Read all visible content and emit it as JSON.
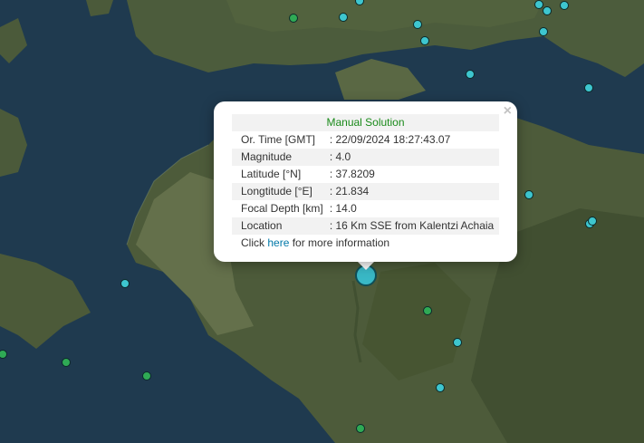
{
  "popup": {
    "close_symbol": "×",
    "title": "Manual Solution",
    "rows": [
      {
        "label": "Or. Time [GMT]",
        "value": ": 22/09/2024 18:27:43.07"
      },
      {
        "label": "Magnitude",
        "value": ": 4.0"
      },
      {
        "label": "Latitude [°N]",
        "value": ": 37.8209"
      },
      {
        "label": "Longtitude [°E]",
        "value": ": 21.834"
      },
      {
        "label": "Focal Depth [km]",
        "value": ": 14.0"
      },
      {
        "label": "Location",
        "value": ": 16 Km SSE from Kalentzi Achaia"
      }
    ],
    "more_prefix": "Click ",
    "more_link": "here",
    "more_suffix": " for more information"
  },
  "colors": {
    "sea": "#1f3a4d",
    "land": "#4a5a3a",
    "marker_cyan": "#3ec6cf",
    "marker_green": "#2faa55",
    "title_green": "#1a8a1a",
    "link_blue": "#0078a8"
  },
  "markers": {
    "selected_icon": "selected-earthquake-marker",
    "other_icons": "earthquake-marker"
  }
}
